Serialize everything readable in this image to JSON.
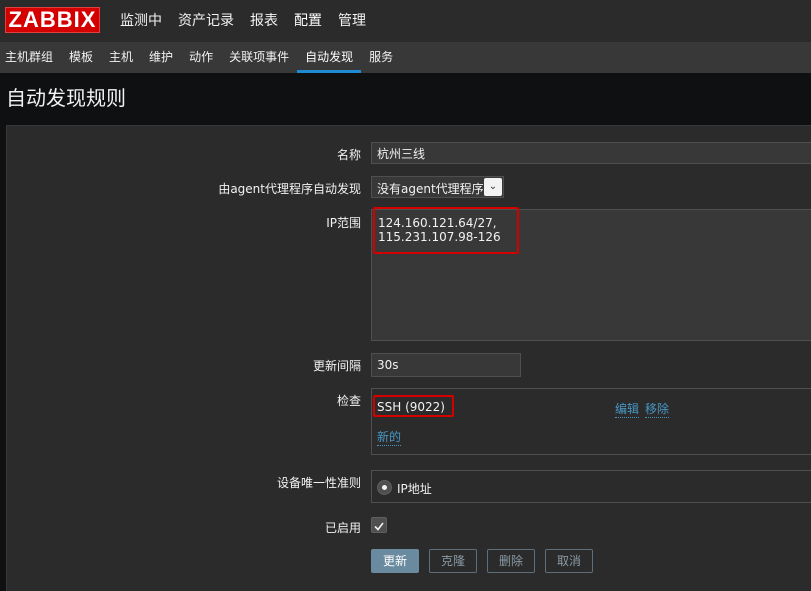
{
  "logo": "ZABBIX",
  "topnav": [
    "监测中",
    "资产记录",
    "报表",
    "配置",
    "管理"
  ],
  "subnav": [
    "主机群组",
    "模板",
    "主机",
    "维护",
    "动作",
    "关联项事件",
    "自动发现",
    "服务"
  ],
  "page_title": "自动发现规则",
  "form": {
    "name_label": "名称",
    "name_value": "杭州三线",
    "proxy_label": "由agent代理程序自动发现",
    "proxy_value": "没有agent代理程序",
    "ip_label": "IP范围",
    "ip_value": "124.160.121.64/27,\n115.231.107.98-126",
    "interval_label": "更新间隔",
    "interval_value": "30s",
    "checks_label": "检查",
    "check_item": "SSH (9022)",
    "edit_link": "编辑",
    "remove_link": "移除",
    "new_link": "新的",
    "uniqueness_label": "设备唯一性准则",
    "uniqueness_option": "IP地址",
    "enabled_label": "已启用",
    "enabled_checked": true
  },
  "buttons": {
    "update": "更新",
    "clone": "克隆",
    "delete": "删除",
    "cancel": "取消"
  },
  "colors": {
    "logo_red": "#d40000",
    "accent_blue": "#1f8bd3",
    "link_blue": "#4796c4",
    "highlight_red": "#d40000"
  }
}
